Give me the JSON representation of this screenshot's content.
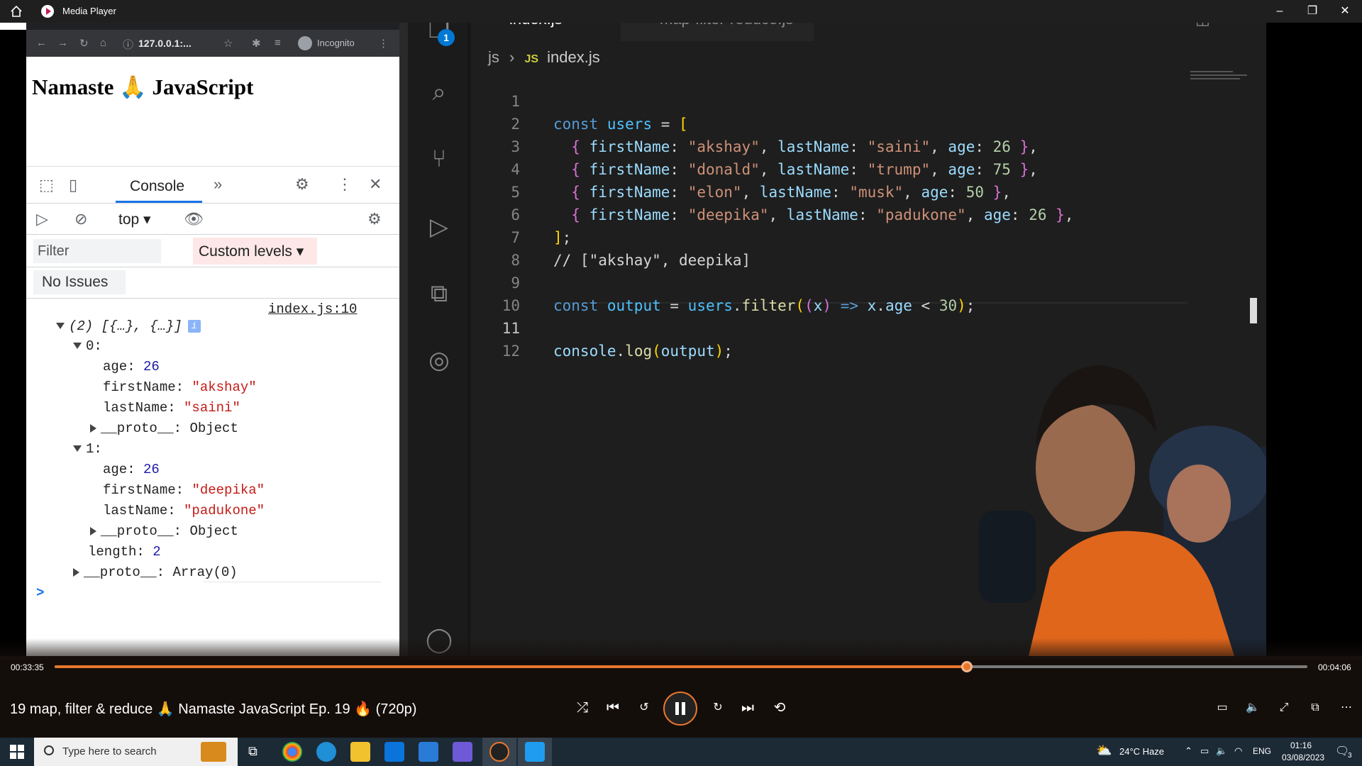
{
  "media_player": {
    "title": "Media Player",
    "elapsed": "00:33:35",
    "total": "00:04:06",
    "progress_fraction": 0.728,
    "video_title": "19 map, filter & reduce 🙏 Namaste JavaScript Ep. 19 🔥 (720p)"
  },
  "browser": {
    "url": "127.0.0.1:...",
    "incognito_label": "Incognito",
    "page_heading": "Namaste 🙏 JavaScript"
  },
  "devtools": {
    "tab_console": "Console",
    "context": "top",
    "filter_placeholder": "Filter",
    "levels": "Custom levels",
    "issues": "No Issues",
    "source_link": "index.js:10",
    "array_summary": "(2) [{…}, {…}]",
    "items": [
      {
        "index": "0:",
        "age": "26",
        "firstName": "\"akshay\"",
        "lastName": "\"saini\""
      },
      {
        "index": "1:",
        "age": "26",
        "firstName": "\"deepika\"",
        "lastName": "\"padukone\""
      }
    ],
    "proto_object": "Object",
    "length_label": "length",
    "length_value": "2",
    "proto_array": "Array(0)",
    "key_age": "age",
    "key_first": "firstName",
    "key_last": "lastName",
    "key_proto": "__proto__",
    "prompt": ">"
  },
  "vscode": {
    "tabs": [
      {
        "icon": "JS",
        "name": "index.js",
        "modified": true
      },
      {
        "icon": "JS",
        "name": "map-filter-reduce.js",
        "modified": false
      }
    ],
    "breadcrumb_folder": "js",
    "breadcrumb_icon": "JS",
    "breadcrumb_file": "index.js",
    "explorer_badge": "1",
    "line_numbers": [
      "1",
      "2",
      "3",
      "4",
      "5",
      "6",
      "7",
      "8",
      "9",
      "10",
      "11",
      "12"
    ],
    "current_line": "11",
    "users": [
      {
        "firstName": "\"akshay\"",
        "lastName": "\"saini\"",
        "age": "26"
      },
      {
        "firstName": "\"donald\"",
        "lastName": "\"trump\"",
        "age": "75"
      },
      {
        "firstName": "\"elon\"",
        "lastName": "\"musk\"",
        "age": "50"
      },
      {
        "firstName": "\"deepika\"",
        "lastName": "\"padukone\"",
        "age": "26"
      }
    ],
    "comment": "// [\"akshay\", deepika]",
    "filter_age": "30"
  },
  "taskbar": {
    "search_placeholder": "Type here to search",
    "weather": "24°C  Haze",
    "language": "ENG",
    "time": "01:16",
    "date": "03/08/2023",
    "notifications": "3"
  },
  "colors": {
    "accent_orange": "#e8762c",
    "vscode_bg": "#1e1e1e",
    "devtools_blue": "#1a73e8"
  }
}
